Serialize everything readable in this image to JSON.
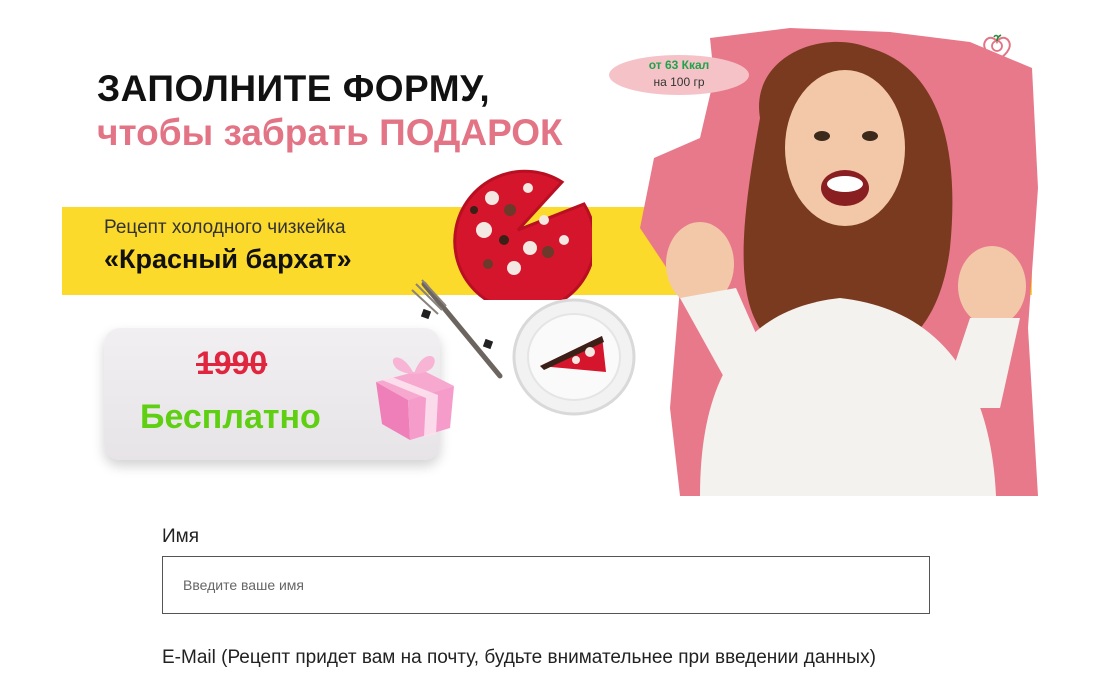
{
  "hero": {
    "headline_line1": "ЗАПОЛНИТЕ ФОРМУ,",
    "headline_line2": "чтобы забрать ПОДАРОК",
    "recipe_subtitle": "Рецепт холодного чизкейка",
    "recipe_name": "«Красный бархат»",
    "old_price": "1990",
    "free_label": "Бесплатно",
    "calories": "от 63 Ккал",
    "calories_unit": "на 100 гр"
  },
  "form": {
    "name_label": "Имя",
    "name_placeholder": "Введите ваше имя",
    "name_value": "",
    "email_label": "E-Mail (Рецепт придет вам на почту, будьте внимательнее при введении данных)"
  },
  "icons": {
    "logo": "heart-apple-icon",
    "gift": "gift-box-icon"
  },
  "colors": {
    "accent_pink": "#e27485",
    "band_yellow": "#fcda2b",
    "old_price_red": "#e0263f",
    "free_green": "#5fcf12",
    "bubble_pink": "#f5c3c7",
    "kcal_green": "#1ea34a"
  }
}
